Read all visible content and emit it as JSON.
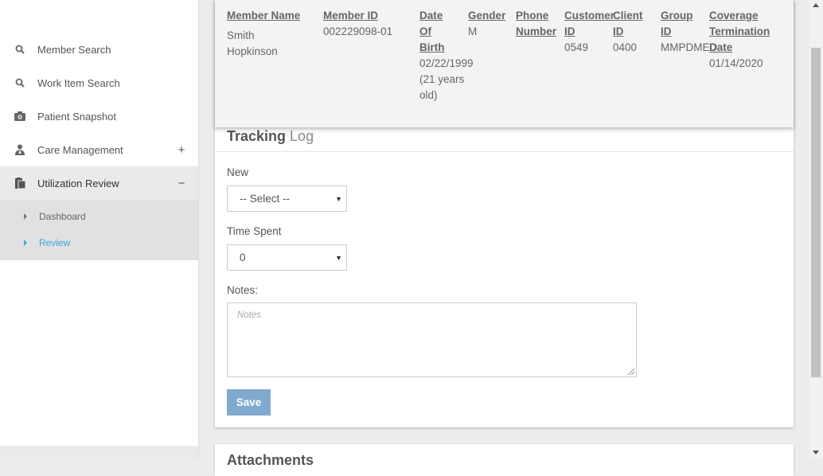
{
  "sidebar": {
    "items": [
      {
        "label": "Member Search",
        "icon": "search-icon"
      },
      {
        "label": "Work Item Search",
        "icon": "search-icon"
      },
      {
        "label": "Patient Snapshot",
        "icon": "camera-icon"
      },
      {
        "label": "Care Management",
        "icon": "user-nurse-icon",
        "control": "+"
      },
      {
        "label": "Utilization Review",
        "icon": "clipboard-icon",
        "control": "−"
      }
    ],
    "subitems": [
      {
        "label": "Dashboard"
      },
      {
        "label": "Review"
      }
    ]
  },
  "member": {
    "columns": [
      {
        "header": "Member Name",
        "value": "Smith Hopkinson"
      },
      {
        "header": "Member ID",
        "value": "002229098-01"
      },
      {
        "header": "Date Of Birth",
        "value": "02/22/1999 (21 years old)"
      },
      {
        "header": "Gender",
        "value": "M"
      },
      {
        "header": "Phone Number",
        "value": ""
      },
      {
        "header": "Customer ID",
        "value": "0549"
      },
      {
        "header": "Client ID",
        "value": "0400"
      },
      {
        "header": "Group ID",
        "value": "MMPDMED"
      },
      {
        "header": "Coverage Termination Date",
        "value": "01/14/2020"
      }
    ]
  },
  "tracking": {
    "title_bold": "Tracking",
    "title_light": "Log",
    "new_label": "New",
    "new_value": "-- Select --",
    "time_label": "Time Spent",
    "time_value": "0",
    "notes_label": "Notes:",
    "notes_placeholder": "Notes",
    "save_label": "Save"
  },
  "attachments": {
    "title": "Attachments"
  },
  "colors": {
    "accent": "#3aa7d6",
    "save_button": "#7faacd"
  }
}
